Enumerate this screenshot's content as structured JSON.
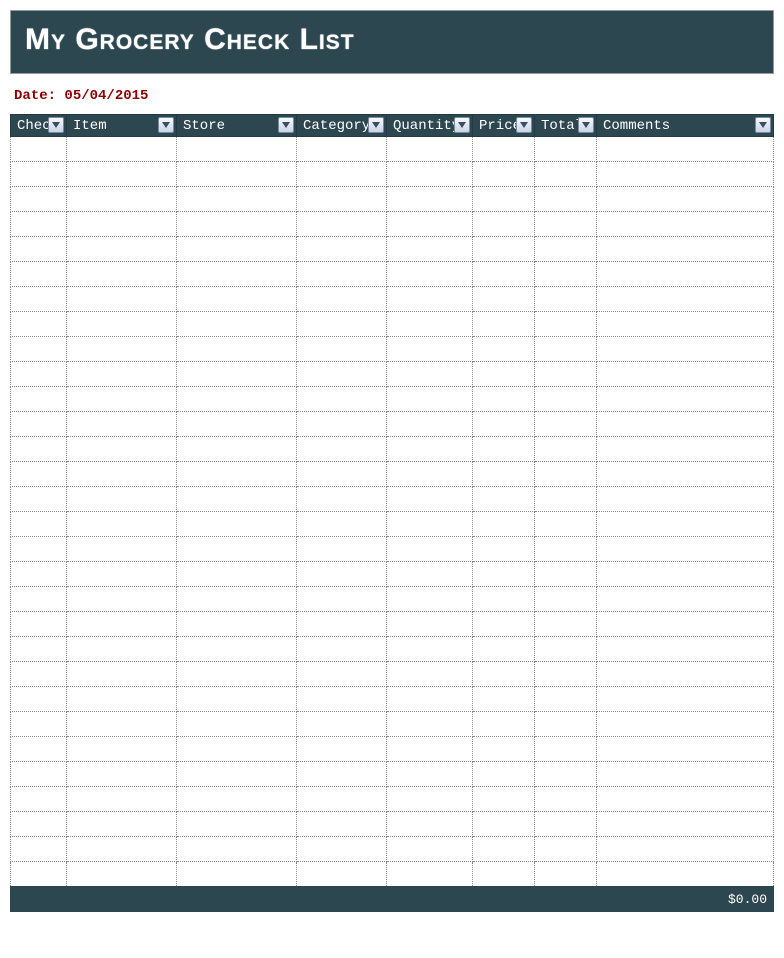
{
  "header": {
    "title": "My Grocery Check List"
  },
  "meta": {
    "date_label": "Date:",
    "date_value": "05/04/2015"
  },
  "table": {
    "columns": [
      {
        "key": "check",
        "label": "Check"
      },
      {
        "key": "item",
        "label": "Item"
      },
      {
        "key": "store",
        "label": "Store"
      },
      {
        "key": "category",
        "label": "Category"
      },
      {
        "key": "quantity",
        "label": "Quantity"
      },
      {
        "key": "price",
        "label": "Price"
      },
      {
        "key": "total",
        "label": "Total"
      },
      {
        "key": "comments",
        "label": "Comments"
      }
    ],
    "row_count": 30,
    "footer_total": "$0.00"
  }
}
